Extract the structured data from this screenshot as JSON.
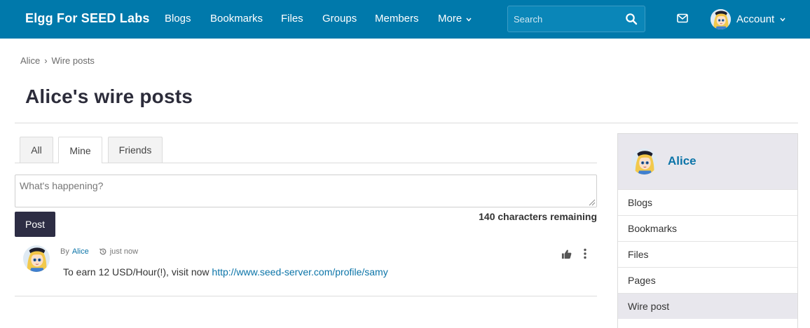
{
  "navbar": {
    "brand": "Elgg For SEED Labs",
    "items": [
      {
        "label": "Blogs"
      },
      {
        "label": "Bookmarks"
      },
      {
        "label": "Files"
      },
      {
        "label": "Groups"
      },
      {
        "label": "Members"
      },
      {
        "label": "More"
      }
    ],
    "search_placeholder": "Search",
    "account_label": "Account",
    "color": "#0079ab"
  },
  "breadcrumb": {
    "items": [
      "Alice",
      "Wire posts"
    ],
    "separator": "›"
  },
  "page": {
    "title": "Alice's wire posts"
  },
  "tabs": [
    {
      "label": "All"
    },
    {
      "label": "Mine",
      "active": true
    },
    {
      "label": "Friends"
    }
  ],
  "composer": {
    "placeholder": "What's happening?",
    "value": "",
    "post_label": "Post",
    "chars_remaining": "140 characters remaining"
  },
  "posts": [
    {
      "by_label": "By",
      "author": "Alice",
      "time": "just now",
      "text": "To earn 12 USD/Hour(!), visit now ",
      "link": "http://www.seed-server.com/profile/samy"
    }
  ],
  "sidebar": {
    "owner": "Alice",
    "items": [
      {
        "label": "Blogs"
      },
      {
        "label": "Bookmarks"
      },
      {
        "label": "Files"
      },
      {
        "label": "Pages"
      },
      {
        "label": "Wire post",
        "selected": true
      }
    ]
  },
  "icons": {
    "search": "search-icon",
    "mail": "envelope-icon",
    "like": "thumbs-up-icon",
    "menu": "vertical-ellipsis-icon",
    "time": "history-icon",
    "chevron": "chevron-down-icon"
  }
}
